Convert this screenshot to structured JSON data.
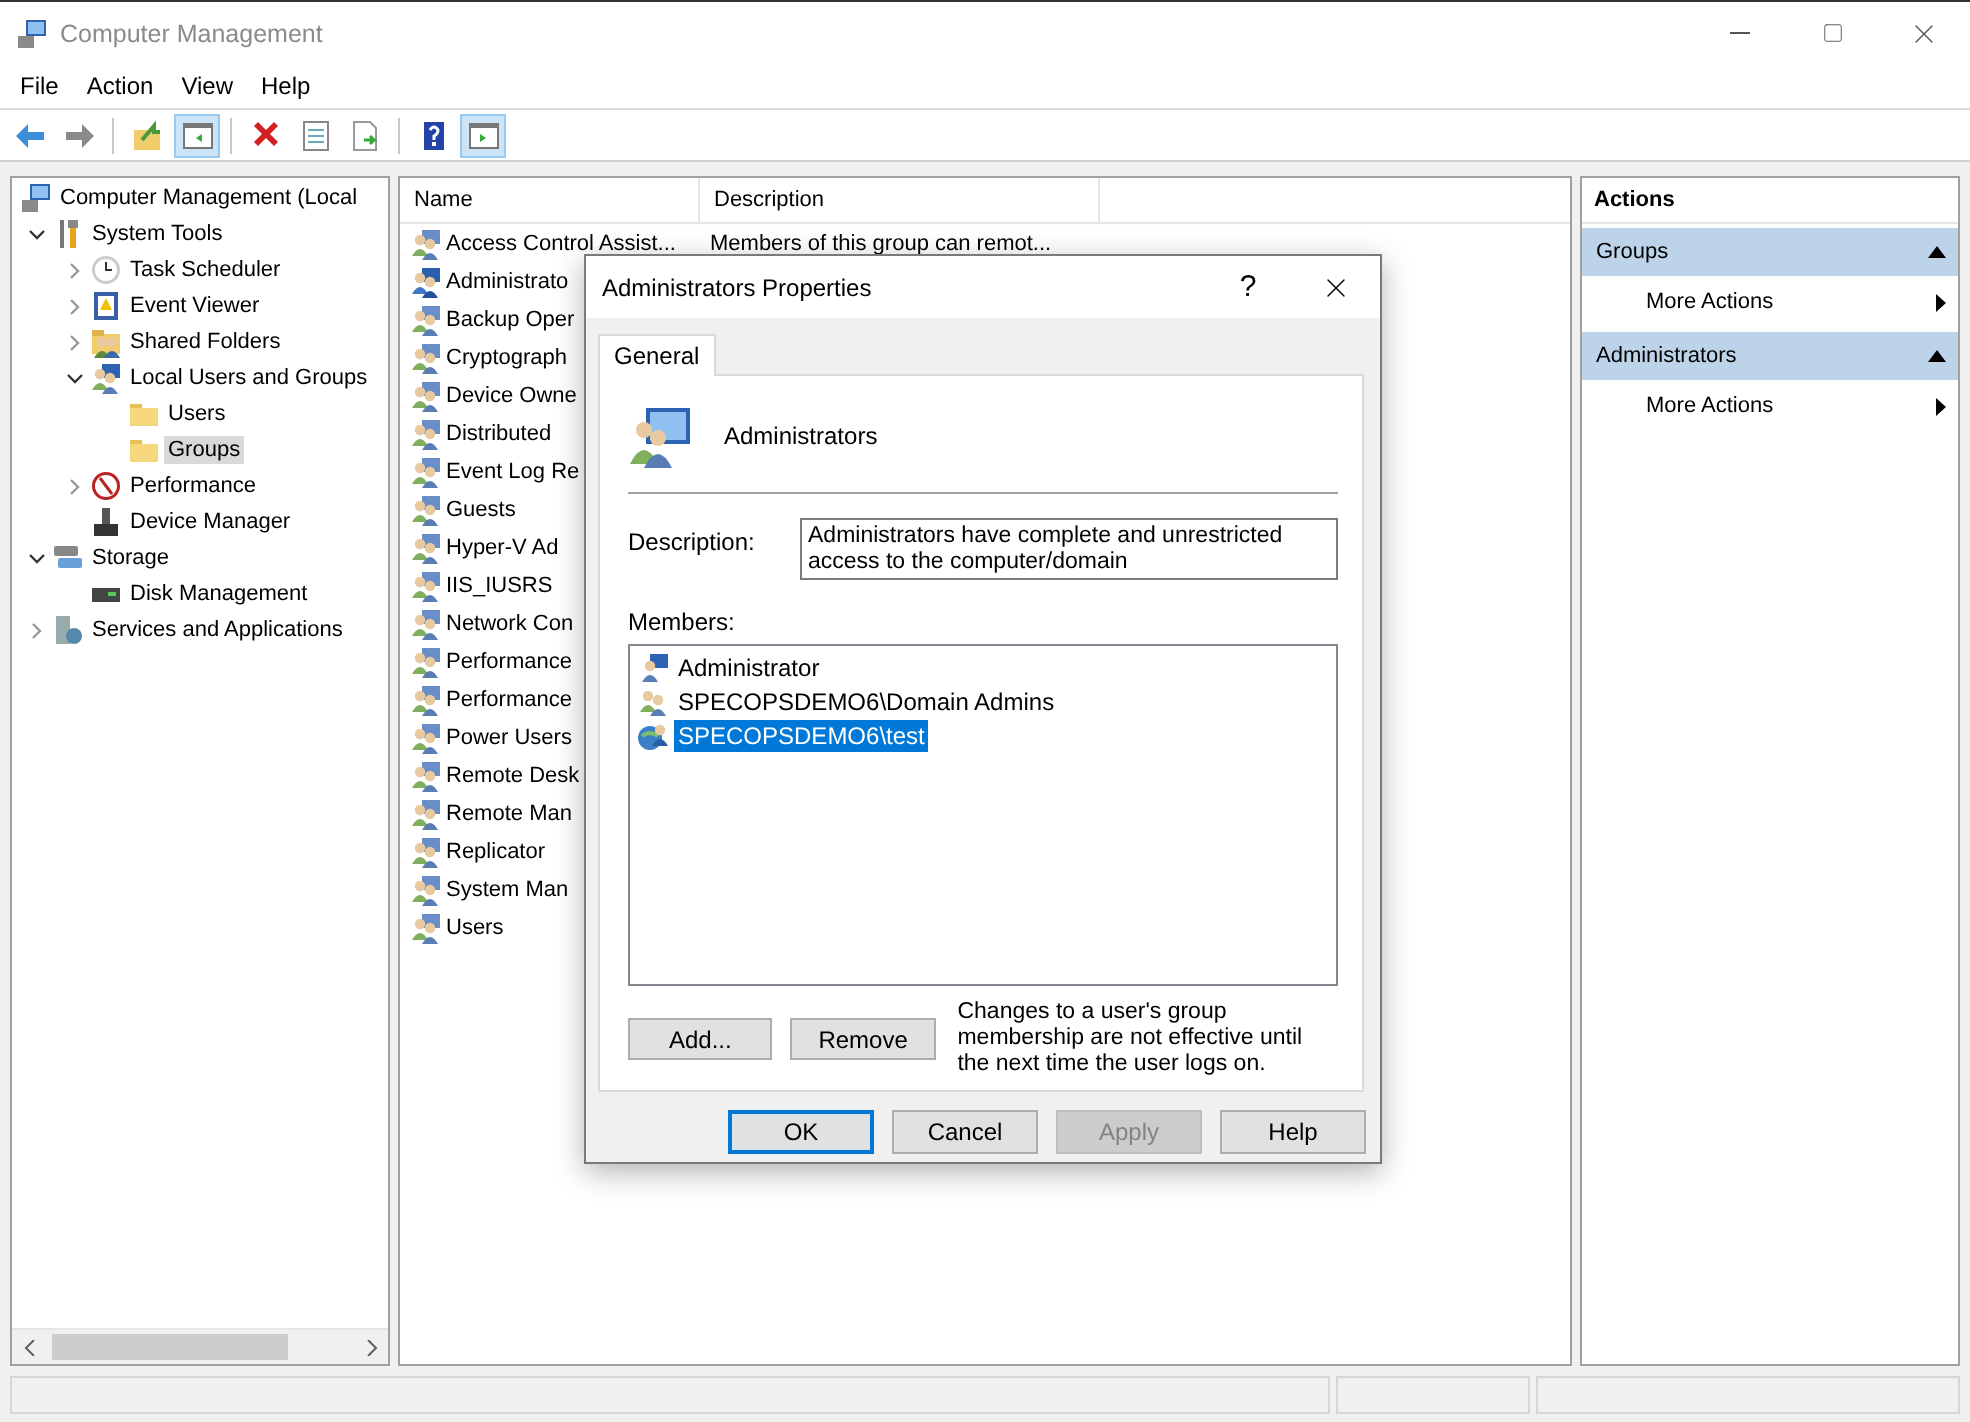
{
  "window": {
    "title": "Computer Management"
  },
  "menu": [
    "File",
    "Action",
    "View",
    "Help"
  ],
  "toolbar": [
    [
      {
        "kind": "back",
        "pressed": false
      },
      {
        "kind": "forward",
        "pressed": false
      }
    ],
    [
      {
        "kind": "up",
        "pressed": false
      },
      {
        "kind": "console-tree",
        "pressed": true
      }
    ],
    [
      {
        "kind": "delete",
        "pressed": false
      },
      {
        "kind": "properties",
        "pressed": false
      },
      {
        "kind": "export",
        "pressed": false
      }
    ],
    [
      {
        "kind": "help",
        "pressed": false
      },
      {
        "kind": "action-pane",
        "pressed": true
      }
    ]
  ],
  "tree": [
    {
      "label": "Computer Management (Local",
      "kind": "computer",
      "selected": false,
      "children": [
        {
          "label": "System Tools",
          "kind": "tools",
          "expanded": true,
          "selected": false,
          "children": [
            {
              "label": "Task Scheduler",
              "kind": "clock",
              "expanded": false,
              "selected": false
            },
            {
              "label": "Event Viewer",
              "kind": "event",
              "expanded": false,
              "selected": false
            },
            {
              "label": "Shared Folders",
              "kind": "share",
              "expanded": false,
              "selected": false
            },
            {
              "label": "Local Users and Groups",
              "kind": "users",
              "expanded": true,
              "selected": false,
              "children": [
                {
                  "label": "Users",
                  "kind": "folder",
                  "selected": false
                },
                {
                  "label": "Groups",
                  "kind": "folder",
                  "selected": true
                }
              ]
            },
            {
              "label": "Performance",
              "kind": "performance",
              "expanded": false,
              "selected": false
            },
            {
              "label": "Device Manager",
              "kind": "device",
              "selected": false
            }
          ]
        },
        {
          "label": "Storage",
          "kind": "storage",
          "expanded": true,
          "selected": false,
          "children": [
            {
              "label": "Disk Management",
              "kind": "disk",
              "selected": false
            }
          ]
        },
        {
          "label": "Services and Applications",
          "kind": "services",
          "expanded": false,
          "selected": false
        }
      ]
    }
  ],
  "groups": {
    "columns": [
      "Name",
      "Description"
    ],
    "rows": [
      {
        "name": "Access Control Assist...",
        "description": "Members of this group can remot...",
        "selected": false
      },
      {
        "name": "Administrato",
        "selected": true
      },
      {
        "name": "Backup Oper",
        "selected": false
      },
      {
        "name": "Cryptograph",
        "selected": false
      },
      {
        "name": "Device Owne",
        "selected": false
      },
      {
        "name": "Distributed",
        "selected": false
      },
      {
        "name": "Event Log Re",
        "selected": false
      },
      {
        "name": "Guests",
        "selected": false
      },
      {
        "name": "Hyper-V Ad",
        "selected": false
      },
      {
        "name": "IIS_IUSRS",
        "selected": false
      },
      {
        "name": "Network Con",
        "selected": false
      },
      {
        "name": "Performance",
        "selected": false
      },
      {
        "name": "Performance",
        "selected": false
      },
      {
        "name": "Power Users",
        "selected": false
      },
      {
        "name": "Remote Desk",
        "selected": false
      },
      {
        "name": "Remote Man",
        "selected": false
      },
      {
        "name": "Replicator",
        "selected": false
      },
      {
        "name": "System Man",
        "selected": false
      },
      {
        "name": "Users",
        "selected": false
      }
    ]
  },
  "actions": {
    "title": "Actions",
    "sections": [
      {
        "title": "Groups",
        "expanded": true,
        "items": [
          "More Actions"
        ]
      },
      {
        "title": "Administrators",
        "expanded": true,
        "items": [
          "More Actions"
        ]
      }
    ]
  },
  "dialog": {
    "title": "Administrators Properties",
    "help": "?",
    "tabs": [
      {
        "label": "General",
        "selected": true
      }
    ],
    "name": "Administrators",
    "description_label": "Description:",
    "description": "Administrators have complete and unrestricted access to the computer/domain",
    "members_label": "Members:",
    "members": [
      {
        "name": "Administrator",
        "kind": "user",
        "selected": false
      },
      {
        "name": "SPECOPSDEMO6\\Domain Admins",
        "kind": "group",
        "selected": false
      },
      {
        "name": "SPECOPSDEMO6\\test",
        "kind": "domain-user",
        "selected": true
      }
    ],
    "member_buttons": [
      "Add...",
      "Remove"
    ],
    "note": "Changes to a user's group membership are not effective until the next time the user logs on.",
    "buttons": [
      {
        "label": "OK",
        "default": true,
        "disabled": false
      },
      {
        "label": "Cancel",
        "default": false,
        "disabled": false
      },
      {
        "label": "Apply",
        "default": false,
        "disabled": true
      },
      {
        "label": "Help",
        "default": false,
        "disabled": false
      }
    ]
  }
}
